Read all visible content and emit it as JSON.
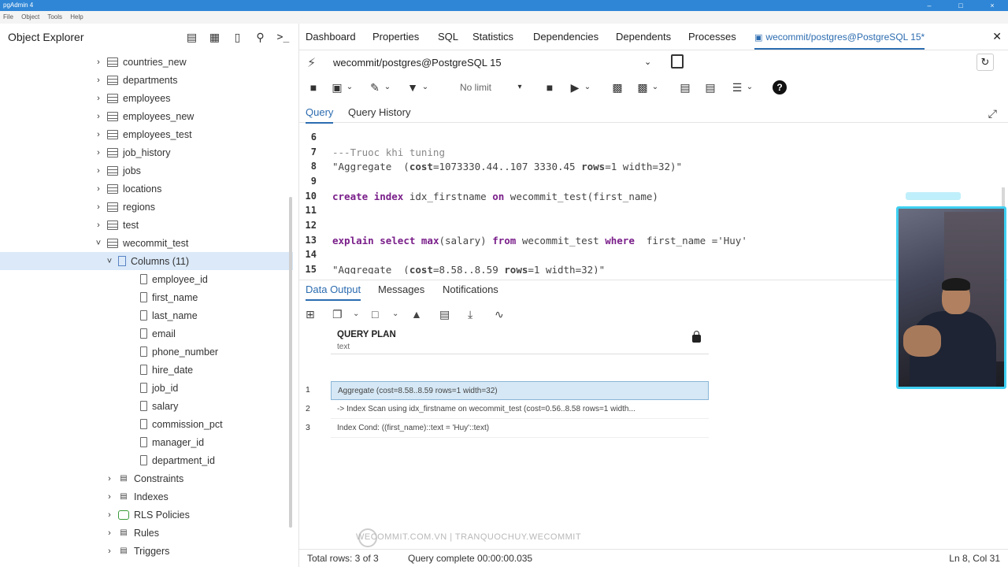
{
  "window": {
    "title": "pgAdmin 4",
    "menu": [
      "File",
      "Object",
      "Tools",
      "Help"
    ]
  },
  "explorer": {
    "title": "Object Explorer",
    "tree": [
      {
        "label": "countries_new",
        "kind": "table",
        "level": 0,
        "chevron": "right"
      },
      {
        "label": "departments",
        "kind": "table",
        "level": 0,
        "chevron": "right"
      },
      {
        "label": "employees",
        "kind": "table",
        "level": 0,
        "chevron": "right"
      },
      {
        "label": "employees_new",
        "kind": "table",
        "level": 0,
        "chevron": "right"
      },
      {
        "label": "employees_test",
        "kind": "table",
        "level": 0,
        "chevron": "right"
      },
      {
        "label": "job_history",
        "kind": "table",
        "level": 0,
        "chevron": "right"
      },
      {
        "label": "jobs",
        "kind": "table",
        "level": 0,
        "chevron": "right"
      },
      {
        "label": "locations",
        "kind": "table",
        "level": 0,
        "chevron": "right"
      },
      {
        "label": "regions",
        "kind": "table",
        "level": 0,
        "chevron": "right"
      },
      {
        "label": "test",
        "kind": "table",
        "level": 0,
        "chevron": "right"
      },
      {
        "label": "wecommit_test",
        "kind": "table",
        "level": 0,
        "chevron": "down"
      },
      {
        "label": "Columns (11)",
        "kind": "columns",
        "level": 1,
        "chevron": "down",
        "selected": true
      },
      {
        "label": "employee_id",
        "kind": "column",
        "level": 2,
        "chevron": ""
      },
      {
        "label": "first_name",
        "kind": "column",
        "level": 2,
        "chevron": ""
      },
      {
        "label": "last_name",
        "kind": "column",
        "level": 2,
        "chevron": ""
      },
      {
        "label": "email",
        "kind": "column",
        "level": 2,
        "chevron": ""
      },
      {
        "label": "phone_number",
        "kind": "column",
        "level": 2,
        "chevron": ""
      },
      {
        "label": "hire_date",
        "kind": "column",
        "level": 2,
        "chevron": ""
      },
      {
        "label": "job_id",
        "kind": "column",
        "level": 2,
        "chevron": ""
      },
      {
        "label": "salary",
        "kind": "column",
        "level": 2,
        "chevron": ""
      },
      {
        "label": "commission_pct",
        "kind": "column",
        "level": 2,
        "chevron": ""
      },
      {
        "label": "manager_id",
        "kind": "column",
        "level": 2,
        "chevron": ""
      },
      {
        "label": "department_id",
        "kind": "column",
        "level": 2,
        "chevron": ""
      },
      {
        "label": "Constraints",
        "kind": "generic",
        "level": 1,
        "chevron": "right"
      },
      {
        "label": "Indexes",
        "kind": "generic",
        "level": 1,
        "chevron": "right"
      },
      {
        "label": "RLS Policies",
        "kind": "rls",
        "level": 1,
        "chevron": "right"
      },
      {
        "label": "Rules",
        "kind": "generic",
        "level": 1,
        "chevron": "right"
      },
      {
        "label": "Triggers",
        "kind": "generic",
        "level": 1,
        "chevron": "right"
      }
    ]
  },
  "main_tabs": [
    "Dashboard",
    "Properties",
    "SQL",
    "Statistics",
    "Dependencies",
    "Dependents",
    "Processes",
    "wecommit/postgres@PostgreSQL 15*"
  ],
  "connection": {
    "name": "wecommit/postgres@PostgreSQL 15"
  },
  "toolbar": {
    "limit": "No limit"
  },
  "query_tabs": [
    "Query",
    "Query History"
  ],
  "editor": {
    "lines": [
      {
        "n": "6",
        "text": ""
      },
      {
        "n": "7",
        "text": "---Truoc khi tuning"
      },
      {
        "n": "8",
        "text": "\"Aggregate  (cost=1073330.44..107 3330.45 rows=1 width=32)\""
      },
      {
        "n": "9",
        "text": ""
      },
      {
        "n": "10",
        "text": "create index idx_firstname on wecommit_test(first_name)"
      },
      {
        "n": "11",
        "text": ""
      },
      {
        "n": "12",
        "text": ""
      },
      {
        "n": "13",
        "text": "explain select max(salary) from wecommit_test where  first_name ='Huy'"
      },
      {
        "n": "14",
        "text": ""
      },
      {
        "n": "15",
        "text": "\"Aggregate  (cost=8.58..8.59 rows=1 width=32)\""
      }
    ]
  },
  "output_tabs": [
    "Data Output",
    "Messages",
    "Notifications"
  ],
  "grid": {
    "column_name": "QUERY PLAN",
    "column_type": "text",
    "rows": [
      {
        "n": "1",
        "value": "Aggregate  (cost=8.58..8.59 rows=1 width=32)"
      },
      {
        "n": "2",
        "value": "  ->  Index Scan using idx_firstname on wecommit_test  (cost=0.56..8.58 rows=1 width..."
      },
      {
        "n": "3",
        "value": "        Index Cond: ((first_name)::text = 'Huy'::text)"
      }
    ]
  },
  "watermark": "WECOMMIT.COM.VN | TRANQUOCHUY.WECOMMIT",
  "status": {
    "rows": "Total rows: 3 of 3",
    "time": "Query complete 00:00:00.035",
    "position": "Ln 8, Col 31"
  },
  "colors": {
    "accent": "#2c6cb0",
    "selection": "#dbe9f9",
    "titlebar": "#2f86d6",
    "webcam_border": "#3fd0f2"
  }
}
